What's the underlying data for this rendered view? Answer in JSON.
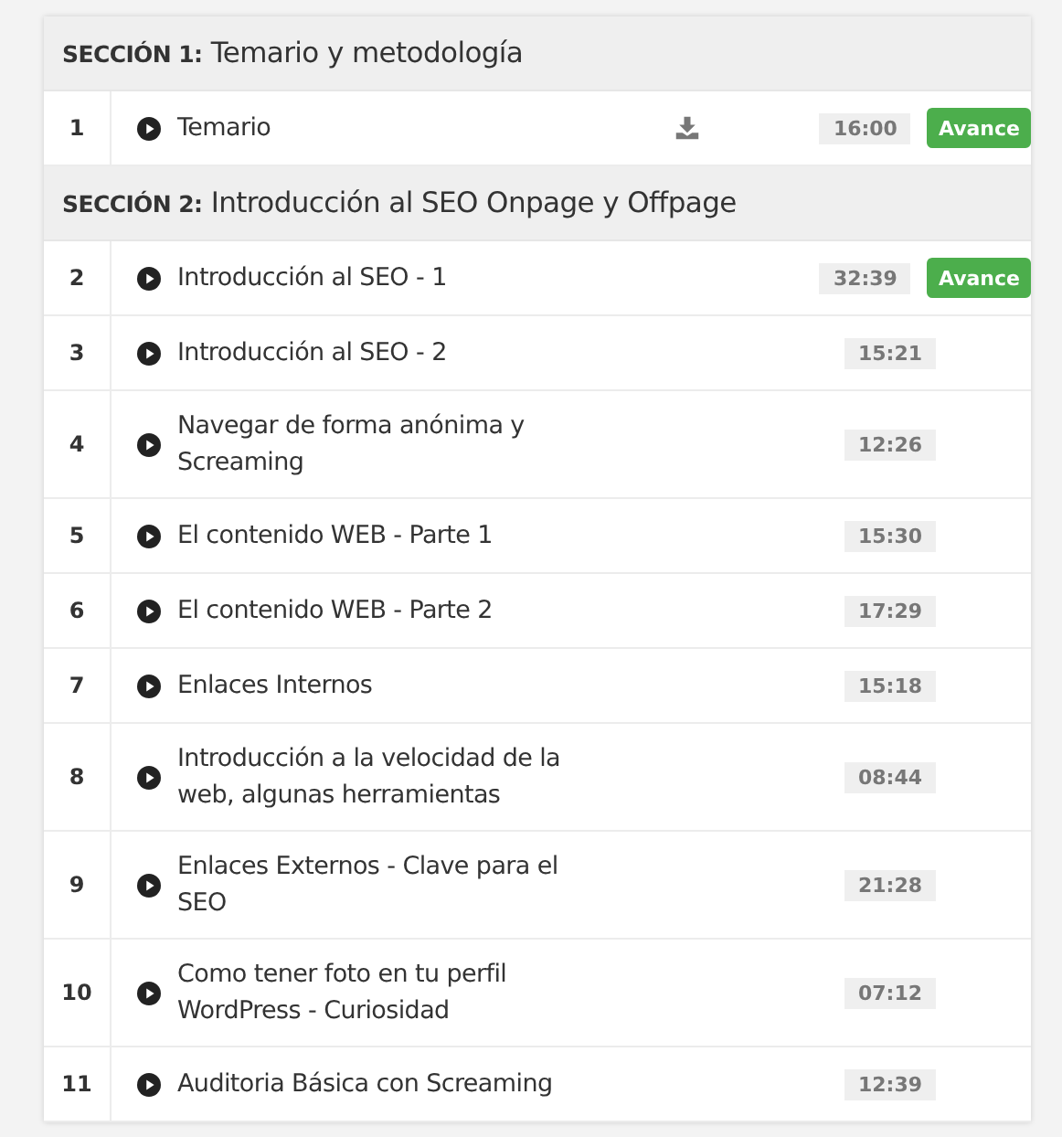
{
  "sections": [
    {
      "label": "SECCIÓN 1:",
      "title": "Temario y metodología",
      "lessons": [
        {
          "number": "1",
          "title": "Temario",
          "downloadable": true,
          "duration": "16:00",
          "badge": "Avance"
        }
      ]
    },
    {
      "label": "SECCIÓN 2:",
      "title": "Introducción al SEO Onpage y Offpage",
      "lessons": [
        {
          "number": "2",
          "title": "Introducción al SEO - 1",
          "downloadable": false,
          "duration": "32:39",
          "badge": "Avance"
        },
        {
          "number": "3",
          "title": "Introducción al SEO - 2",
          "downloadable": false,
          "duration": "15:21"
        },
        {
          "number": "4",
          "title": "Navegar de forma anónima y Screaming",
          "downloadable": false,
          "duration": "12:26"
        },
        {
          "number": "5",
          "title": "El contenido WEB - Parte 1",
          "downloadable": false,
          "duration": "15:30"
        },
        {
          "number": "6",
          "title": "El contenido WEB - Parte 2",
          "downloadable": false,
          "duration": "17:29"
        },
        {
          "number": "7",
          "title": "Enlaces Internos",
          "downloadable": false,
          "duration": "15:18"
        },
        {
          "number": "8",
          "title": "Introducción a la velocidad de la web, algunas herramientas",
          "downloadable": false,
          "duration": "08:44"
        },
        {
          "number": "9",
          "title": "Enlaces Externos - Clave para el SEO",
          "downloadable": false,
          "duration": "21:28"
        },
        {
          "number": "10",
          "title": "Como tener foto en tu perfil WordPress - Curiosidad",
          "downloadable": false,
          "duration": "07:12"
        },
        {
          "number": "11",
          "title": "Auditoria Básica con Screaming",
          "downloadable": false,
          "duration": "12:39"
        }
      ]
    }
  ]
}
